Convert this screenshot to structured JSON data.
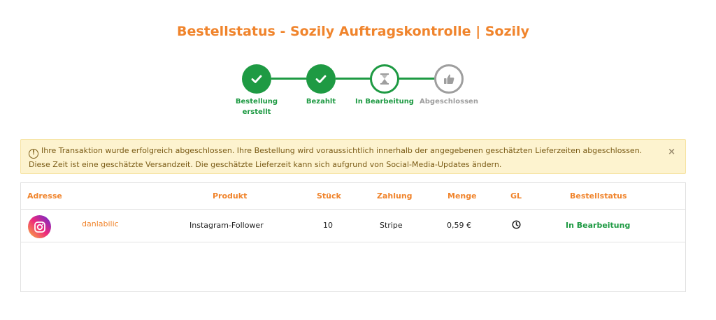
{
  "page": {
    "title": "Bestellstatus - Sozily Auftragskontrolle | Sozily"
  },
  "progress": {
    "steps": [
      {
        "label_line1": "Bestellung",
        "label_line2": "erstellt",
        "state": "done",
        "icon": "check-icon"
      },
      {
        "label_line1": "Bezahlt",
        "label_line2": "",
        "state": "done",
        "icon": "check-icon"
      },
      {
        "label_line1": "In Bearbeitung",
        "label_line2": "",
        "state": "active",
        "icon": "hourglass-icon"
      },
      {
        "label_line1": "Abgeschlossen",
        "label_line2": "",
        "state": "pending",
        "icon": "thumbs-up-icon"
      }
    ]
  },
  "alert": {
    "icon": "exclamation-circle-icon",
    "line1": "Ihre Transaktion wurde erfolgreich abgeschlossen. Ihre Bestellung wird voraussichtlich innerhalb der angegebenen geschätzten Lieferzeiten abgeschlossen.",
    "line2": "Diese Zeit ist eine geschätzte Versandzeit. Die geschätzte Lieferzeit kann sich aufgrund von Social-Media-Updates ändern.",
    "close_label": "×"
  },
  "table": {
    "headers": {
      "address": "Adresse",
      "product": "Produkt",
      "quantity": "Stück",
      "payment": "Zahlung",
      "amount": "Menge",
      "gl": "GL",
      "status": "Bestellstatus"
    },
    "rows": [
      {
        "platform_icon": "instagram-icon",
        "username": "danlabilic",
        "product": "Instagram-Follower",
        "quantity": "10",
        "payment": "Stripe",
        "amount": "0,59 €",
        "gl_icon": "clock-icon",
        "status": "In Bearbeitung"
      }
    ]
  },
  "colors": {
    "accent": "#f0842c",
    "success": "#1e9a43",
    "pending": "#9e9e9e",
    "alert_bg": "#fdf3cf"
  }
}
